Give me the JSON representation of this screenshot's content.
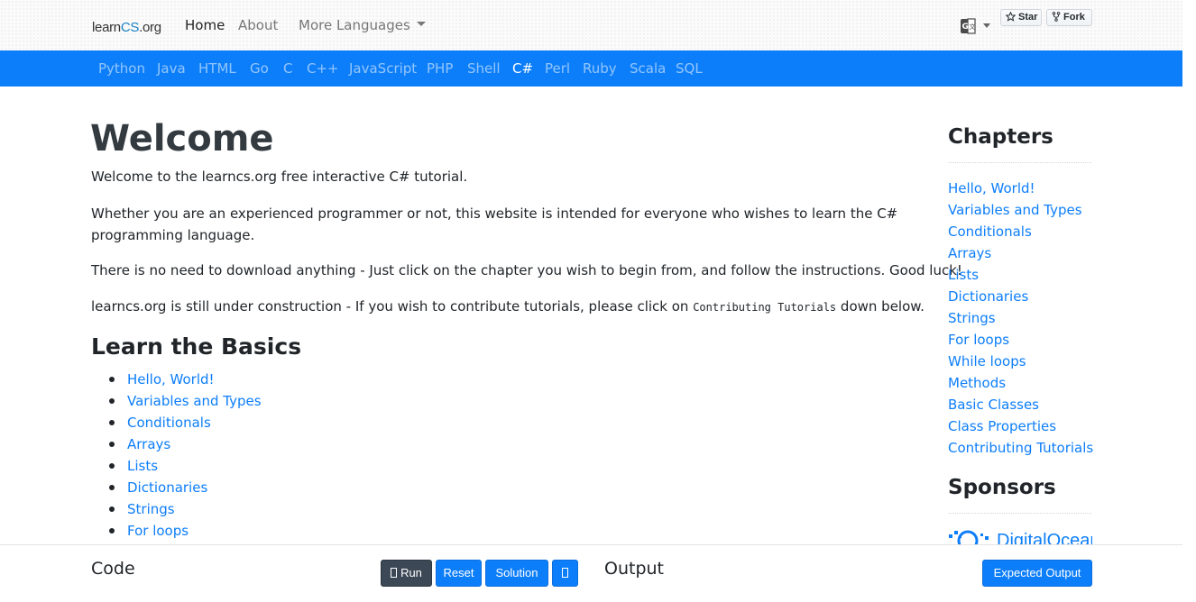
{
  "header": {
    "brand_prefix": "learn",
    "brand_highlight": "CS",
    "brand_suffix": ".org",
    "nav": {
      "home": "Home",
      "about": "About",
      "more_languages": "More Languages"
    },
    "github": {
      "star_label": "Star",
      "fork_label": "Fork"
    }
  },
  "languages": [
    "Python",
    "Java",
    "HTML",
    "Go",
    "C",
    "C++",
    "JavaScript",
    "PHP",
    "Shell",
    "C#",
    "Perl",
    "Ruby",
    "Scala",
    "SQL"
  ],
  "active_language": "C#",
  "main": {
    "title": "Welcome",
    "intro": "Welcome to the learncs.org free interactive C# tutorial.",
    "para2_line1": "Whether you are an experienced programmer or not, this website is intended for everyone who wishes to learn the C#",
    "para2_line2": "programming language.",
    "para3": "There is no need to download anything - Just click on the chapter you wish to begin from, and follow the instructions. Good luck!",
    "para4_before": "learncs.org is still under construction - If you wish to contribute tutorials, please click on ",
    "para4_code": "Contributing Tutorials",
    "para4_after": " down below.",
    "basics_heading": "Learn the Basics",
    "basics": [
      "Hello, World!",
      "Variables and Types",
      "Conditionals",
      "Arrays",
      "Lists",
      "Dictionaries",
      "Strings",
      "For loops"
    ]
  },
  "sidebar": {
    "chapters_heading": "Chapters",
    "chapters": [
      "Hello, World!",
      "Variables and Types",
      "Conditionals",
      "Arrays",
      "Lists",
      "Dictionaries",
      "Strings",
      "For loops",
      "While loops",
      "Methods",
      "Basic Classes",
      "Class Properties",
      "Contributing Tutorials"
    ],
    "sponsors_heading": "Sponsors",
    "sponsor_name": "DigitalOcean"
  },
  "bottom": {
    "code_title": "Code",
    "output_title": "Output",
    "run_label": "Run",
    "reset_label": "Reset",
    "solution_label": "Solution",
    "expected_output_label": "Expected Output"
  },
  "colors": {
    "accent": "#0d7ef9",
    "run_button": "#3c4855"
  }
}
